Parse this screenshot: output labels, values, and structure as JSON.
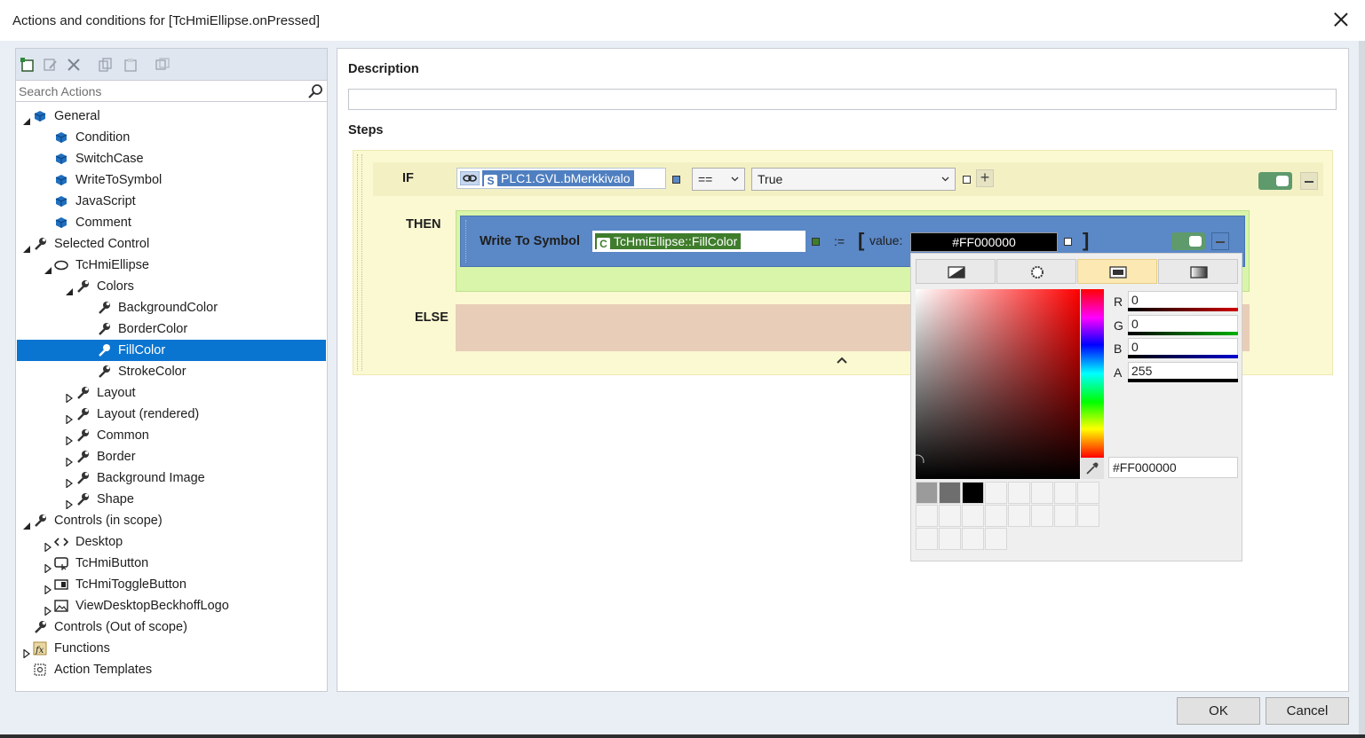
{
  "window": {
    "title": "Actions and conditions for [TcHmiEllipse.onPressed]"
  },
  "search": {
    "placeholder": "Search Actions"
  },
  "tree": [
    {
      "label": "General",
      "icon": "cube-icon",
      "indent": 0,
      "arrow": "expanded"
    },
    {
      "label": "Condition",
      "icon": "cube-icon",
      "indent": 1,
      "arrow": "none"
    },
    {
      "label": "SwitchCase",
      "icon": "cube-icon",
      "indent": 1,
      "arrow": "none"
    },
    {
      "label": "WriteToSymbol",
      "icon": "cube-icon",
      "indent": 1,
      "arrow": "none"
    },
    {
      "label": "JavaScript",
      "icon": "cube-icon",
      "indent": 1,
      "arrow": "none"
    },
    {
      "label": "Comment",
      "icon": "cube-icon",
      "indent": 1,
      "arrow": "none"
    },
    {
      "label": "Selected Control",
      "icon": "wrench-icon",
      "indent": 0,
      "arrow": "expanded"
    },
    {
      "label": "TcHmiEllipse",
      "icon": "ellipse-icon",
      "indent": 1,
      "arrow": "expanded"
    },
    {
      "label": "Colors",
      "icon": "wrench-icon",
      "indent": 2,
      "arrow": "expanded"
    },
    {
      "label": "BackgroundColor",
      "icon": "wrench-icon",
      "indent": 3,
      "arrow": "none"
    },
    {
      "label": "BorderColor",
      "icon": "wrench-icon",
      "indent": 3,
      "arrow": "none"
    },
    {
      "label": "FillColor",
      "icon": "wrench-icon",
      "indent": 3,
      "arrow": "none",
      "selected": true
    },
    {
      "label": "StrokeColor",
      "icon": "wrench-icon",
      "indent": 3,
      "arrow": "none"
    },
    {
      "label": "Layout",
      "icon": "wrench-icon",
      "indent": 2,
      "arrow": "collapsed"
    },
    {
      "label": "Layout (rendered)",
      "icon": "wrench-icon",
      "indent": 2,
      "arrow": "collapsed"
    },
    {
      "label": "Common",
      "icon": "wrench-icon",
      "indent": 2,
      "arrow": "collapsed"
    },
    {
      "label": "Border",
      "icon": "wrench-icon",
      "indent": 2,
      "arrow": "collapsed"
    },
    {
      "label": "Background Image",
      "icon": "wrench-icon",
      "indent": 2,
      "arrow": "collapsed"
    },
    {
      "label": "Shape",
      "icon": "wrench-icon",
      "indent": 2,
      "arrow": "collapsed"
    },
    {
      "label": "Controls (in scope)",
      "icon": "wrench-icon",
      "indent": 0,
      "arrow": "expanded"
    },
    {
      "label": "Desktop",
      "icon": "code-icon",
      "indent": 1,
      "arrow": "collapsed"
    },
    {
      "label": "TcHmiButton",
      "icon": "button-icon",
      "indent": 1,
      "arrow": "collapsed"
    },
    {
      "label": "TcHmiToggleButton",
      "icon": "toggle-button-icon",
      "indent": 1,
      "arrow": "collapsed"
    },
    {
      "label": "ViewDesktopBeckhoffLogo",
      "icon": "image-icon",
      "indent": 1,
      "arrow": "collapsed"
    },
    {
      "label": "Controls (Out of scope)",
      "icon": "wrench-icon",
      "indent": 0,
      "arrow": "none"
    },
    {
      "label": "Functions",
      "icon": "function-icon",
      "indent": 0,
      "arrow": "collapsed"
    },
    {
      "label": "Action Templates",
      "icon": "template-icon",
      "indent": 0,
      "arrow": "none"
    }
  ],
  "main": {
    "description_label": "Description",
    "description_value": "",
    "steps_label": "Steps",
    "if_keyword": "IF",
    "then_keyword": "THEN",
    "else_keyword": "ELSE",
    "condition_symbol_badge": "S",
    "condition_symbol": "PLC1.GVL.bMerkkivalo",
    "operator": "==",
    "compare_value": "True",
    "write_title": "Write To Symbol",
    "write_symbol_badge": "C",
    "write_symbol": "TcHmiEllipse::FillColor",
    "assign_op": ":=",
    "bracket_open": "[",
    "bracket_close": "]",
    "value_label": "value:",
    "value": "#FF000000"
  },
  "picker": {
    "tabs": [
      "no-color-icon",
      "radial-gradient-icon",
      "solid-color-icon",
      "linear-gradient-icon"
    ],
    "active_tab": 2,
    "channels": [
      {
        "label": "R",
        "value": "0",
        "color": "#d00000"
      },
      {
        "label": "G",
        "value": "0",
        "color": "#00b000"
      },
      {
        "label": "B",
        "value": "0",
        "color": "#0000d0"
      },
      {
        "label": "A",
        "value": "255",
        "color": "#000000"
      }
    ],
    "hex": "#FF000000",
    "swatches": [
      "#9b9b9b",
      "#6e6e6e",
      "#000000"
    ]
  },
  "footer": {
    "ok_label": "OK",
    "cancel_label": "Cancel"
  },
  "colors": {
    "selection": "#0a74d1",
    "if_bg": "#fbf9d1",
    "then_bg": "#d9f5aa",
    "action_bg": "#5b88c6",
    "else_bg": "#e8cdb8",
    "toggle": "#5e9a6c"
  }
}
